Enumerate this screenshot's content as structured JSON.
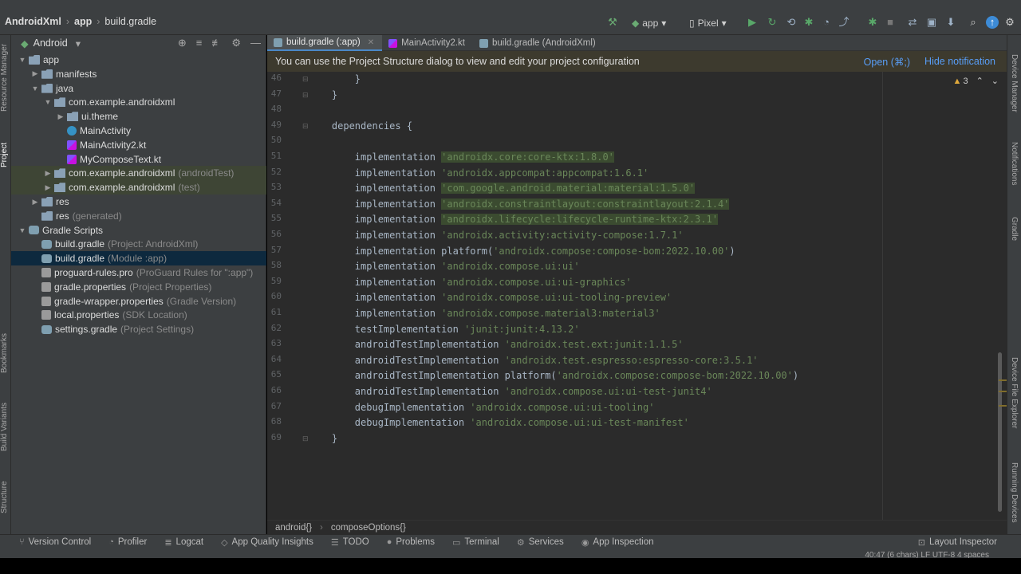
{
  "breadcrumb": {
    "project": "AndroidXml",
    "module": "app",
    "file": "build.gradle"
  },
  "toolbar": {
    "run_config": "app",
    "device": "Pixel"
  },
  "left_strip": {
    "resource_manager": "Resource Manager",
    "project": "Project",
    "bookmarks": "Bookmarks",
    "build_variants": "Build Variants",
    "structure": "Structure"
  },
  "right_strip": {
    "device_manager": "Device Manager",
    "notifications": "Notifications",
    "gradle": "Gradle",
    "device_file_explorer": "Device File Explorer",
    "running_devices": "Running Devices"
  },
  "project_panel": {
    "view": "Android",
    "items": [
      {
        "label": "app",
        "hint": "",
        "icon": "folder-icon",
        "arrow": "▼"
      },
      {
        "label": "manifests",
        "hint": "",
        "icon": "folder-icon",
        "arrow": "▶"
      },
      {
        "label": "java",
        "hint": "",
        "icon": "folder-icon",
        "arrow": "▼"
      },
      {
        "label": "com.example.androidxml",
        "hint": "",
        "icon": "package-icon",
        "arrow": "▼"
      },
      {
        "label": "ui.theme",
        "hint": "",
        "icon": "package-icon",
        "arrow": "▶"
      },
      {
        "label": "MainActivity",
        "hint": "",
        "icon": "class-icon",
        "arrow": ""
      },
      {
        "label": "MainActivity2.kt",
        "hint": "",
        "icon": "kotlin-file-icon",
        "arrow": ""
      },
      {
        "label": "MyComposeText.kt",
        "hint": "",
        "icon": "kotlin-file-icon",
        "arrow": ""
      },
      {
        "label": "com.example.androidxml",
        "hint": "(androidTest)",
        "icon": "package-icon",
        "arrow": "▶"
      },
      {
        "label": "com.example.androidxml",
        "hint": "(test)",
        "icon": "package-icon",
        "arrow": "▶"
      },
      {
        "label": "res",
        "hint": "",
        "icon": "folder-icon",
        "arrow": "▶"
      },
      {
        "label": "res",
        "hint": "(generated)",
        "icon": "folder-icon",
        "arrow": ""
      },
      {
        "label": "Gradle Scripts",
        "hint": "",
        "icon": "gradle-icon",
        "arrow": "▼"
      },
      {
        "label": "build.gradle",
        "hint": "(Project: AndroidXml)",
        "icon": "gradle-icon",
        "arrow": ""
      },
      {
        "label": "build.gradle",
        "hint": "(Module :app)",
        "icon": "gradle-icon",
        "arrow": ""
      },
      {
        "label": "proguard-rules.pro",
        "hint": "(ProGuard Rules for \":app\")",
        "icon": "file-icon",
        "arrow": ""
      },
      {
        "label": "gradle.properties",
        "hint": "(Project Properties)",
        "icon": "properties-icon",
        "arrow": ""
      },
      {
        "label": "gradle-wrapper.properties",
        "hint": "(Gradle Version)",
        "icon": "properties-icon",
        "arrow": ""
      },
      {
        "label": "local.properties",
        "hint": "(SDK Location)",
        "icon": "properties-icon",
        "arrow": ""
      },
      {
        "label": "settings.gradle",
        "hint": "(Project Settings)",
        "icon": "gradle-icon",
        "arrow": ""
      }
    ]
  },
  "tabs": [
    {
      "label": "build.gradle (:app)",
      "active": true
    },
    {
      "label": "MainActivity2.kt",
      "active": false
    },
    {
      "label": "build.gradle (AndroidXml)",
      "active": false
    }
  ],
  "notification": {
    "message": "You can use the Project Structure dialog to view and edit your project configuration",
    "open": "Open (⌘;)",
    "hide": "Hide notification"
  },
  "warnings": {
    "count": "3"
  },
  "code_lines": [
    {
      "n": "46",
      "pre": "        }",
      "str": "",
      "post": ""
    },
    {
      "n": "47",
      "pre": "    }",
      "str": "",
      "post": ""
    },
    {
      "n": "48",
      "pre": "",
      "str": "",
      "post": ""
    },
    {
      "n": "49",
      "pre": "    dependencies {",
      "str": "",
      "post": ""
    },
    {
      "n": "50",
      "pre": "",
      "str": "",
      "post": ""
    },
    {
      "n": "51",
      "pre": "        implementation ",
      "str": "'androidx.core:core-ktx:1.8.0'",
      "post": ""
    },
    {
      "n": "52",
      "pre": "        implementation ",
      "str": "'androidx.appcompat:appcompat:1.6.1'",
      "post": ""
    },
    {
      "n": "53",
      "pre": "        implementation ",
      "str": "'com.google.android.material:material:1.5.0'",
      "post": ""
    },
    {
      "n": "54",
      "pre": "        implementation ",
      "str": "'androidx.constraintlayout:constraintlayout:2.1.4'",
      "post": ""
    },
    {
      "n": "55",
      "pre": "        implementation ",
      "str": "'androidx.lifecycle:lifecycle-runtime-ktx:2.3.1'",
      "post": ""
    },
    {
      "n": "56",
      "pre": "        implementation ",
      "str": "'androidx.activity:activity-compose:1.7.1'",
      "post": ""
    },
    {
      "n": "57",
      "pre": "        implementation platform(",
      "str": "'androidx.compose:compose-bom:2022.10.00'",
      "post": ")"
    },
    {
      "n": "58",
      "pre": "        implementation ",
      "str": "'androidx.compose.ui:ui'",
      "post": ""
    },
    {
      "n": "59",
      "pre": "        implementation ",
      "str": "'androidx.compose.ui:ui-graphics'",
      "post": ""
    },
    {
      "n": "60",
      "pre": "        implementation ",
      "str": "'androidx.compose.ui:ui-tooling-preview'",
      "post": ""
    },
    {
      "n": "61",
      "pre": "        implementation ",
      "str": "'androidx.compose.material3:material3'",
      "post": ""
    },
    {
      "n": "62",
      "pre": "        testImplementation ",
      "str": "'junit:junit:4.13.2'",
      "post": ""
    },
    {
      "n": "63",
      "pre": "        androidTestImplementation ",
      "str": "'androidx.test.ext:junit:1.1.5'",
      "post": ""
    },
    {
      "n": "64",
      "pre": "        androidTestImplementation ",
      "str": "'androidx.test.espresso:espresso-core:3.5.1'",
      "post": ""
    },
    {
      "n": "65",
      "pre": "        androidTestImplementation platform(",
      "str": "'androidx.compose:compose-bom:2022.10.00'",
      "post": ")"
    },
    {
      "n": "66",
      "pre": "        androidTestImplementation ",
      "str": "'androidx.compose.ui:ui-test-junit4'",
      "post": ""
    },
    {
      "n": "67",
      "pre": "        debugImplementation ",
      "str": "'androidx.compose.ui:ui-tooling'",
      "post": ""
    },
    {
      "n": "68",
      "pre": "        debugImplementation ",
      "str": "'androidx.compose.ui:ui-test-manifest'",
      "post": ""
    },
    {
      "n": "69",
      "pre": "    }",
      "str": "",
      "post": ""
    }
  ],
  "code_crumbs": [
    "android{}",
    "composeOptions{}"
  ],
  "bottom_tools": [
    {
      "label": "Version Control",
      "icon": "branch-icon"
    },
    {
      "label": "Profiler",
      "icon": "profiler-icon"
    },
    {
      "label": "Logcat",
      "icon": "logcat-icon"
    },
    {
      "label": "App Quality Insights",
      "icon": "insights-icon"
    },
    {
      "label": "TODO",
      "icon": "list-icon"
    },
    {
      "label": "Problems",
      "icon": "problems-icon"
    },
    {
      "label": "Terminal",
      "icon": "terminal-icon"
    },
    {
      "label": "Services",
      "icon": "services-icon"
    },
    {
      "label": "App Inspection",
      "icon": "inspection-icon"
    }
  ],
  "layout_inspector": "Layout Inspector",
  "status": "40:47 (6 chars)    LF    UTF-8    4 spaces",
  "colors": {
    "accent": "#4a88c7",
    "string": "#6a8759",
    "keyword": "#cc7832",
    "bg": "#2b2b2b",
    "panel": "#3c3f41"
  }
}
